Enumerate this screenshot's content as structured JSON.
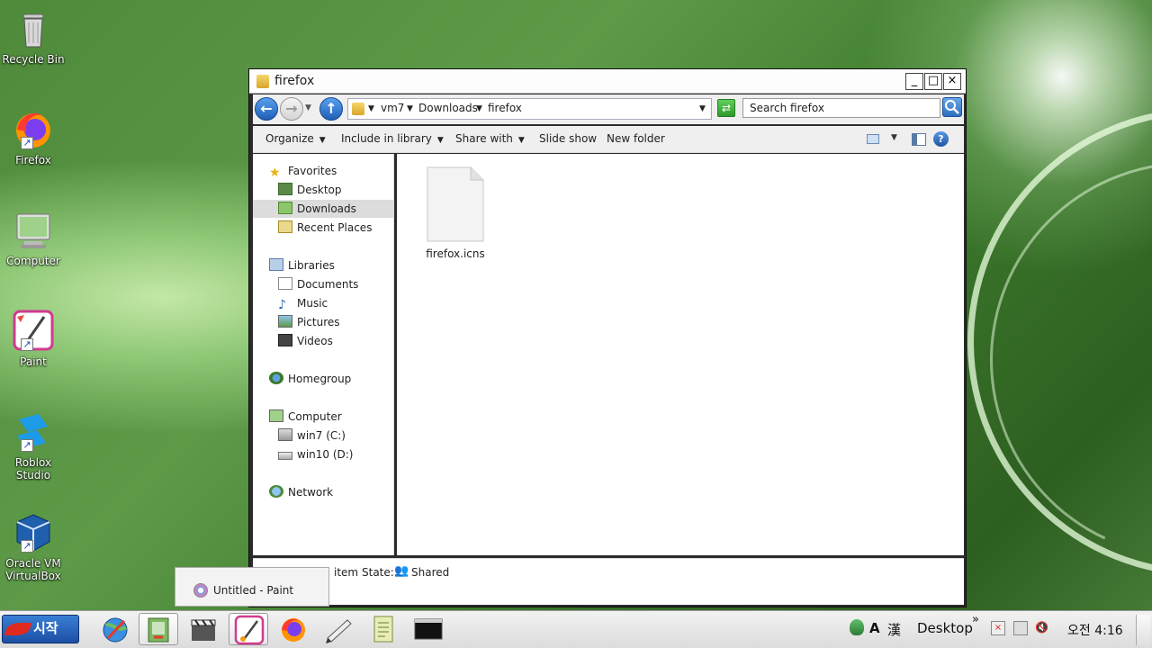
{
  "desktop": {
    "icons": [
      {
        "label": "Recycle Bin"
      },
      {
        "label": "Firefox"
      },
      {
        "label": "Computer"
      },
      {
        "label": "Paint"
      },
      {
        "label_line1": "Roblox",
        "label_line2": "Studio"
      },
      {
        "label_line1": "Oracle VM",
        "label_line2": "VirtualBox"
      }
    ]
  },
  "window": {
    "title": "firefox",
    "controls": {
      "minimize": "_",
      "maximize": "□",
      "close": "×"
    },
    "breadcrumb": [
      "vm7",
      "Downloads",
      "firefox"
    ],
    "search_placeholder": "Search firefox",
    "toolbar": {
      "organize": "Organize",
      "include_in_library": "Include in library",
      "share_with": "Share with",
      "slide_show": "Slide show",
      "new_folder": "New folder"
    },
    "nav": {
      "favorites": "Favorites",
      "desktop": "Desktop",
      "downloads": "Downloads",
      "recent_places": "Recent Places",
      "libraries": "Libraries",
      "documents": "Documents",
      "music": "Music",
      "pictures": "Pictures",
      "videos": "Videos",
      "homegroup": "Homegroup",
      "computer": "Computer",
      "drive_c": "win7 (C:)",
      "drive_d": "win10 (D:)",
      "network": "Network"
    },
    "selected_nav": "Downloads",
    "files": [
      {
        "name": "firefox.icns"
      }
    ],
    "details": {
      "count_text": "item",
      "state_label": "State:",
      "state_value": "Shared"
    }
  },
  "taskbar": {
    "start_label": "시작",
    "popup_label": "Untitled - Paint",
    "tray": {
      "ime_a": "A",
      "ime_han": "漢",
      "desktop_label": "Desktop",
      "expand": "»",
      "time": "오전 4:16"
    }
  },
  "colors": {
    "accent": "#2c6ec0",
    "selection": "#dcdcdc"
  }
}
